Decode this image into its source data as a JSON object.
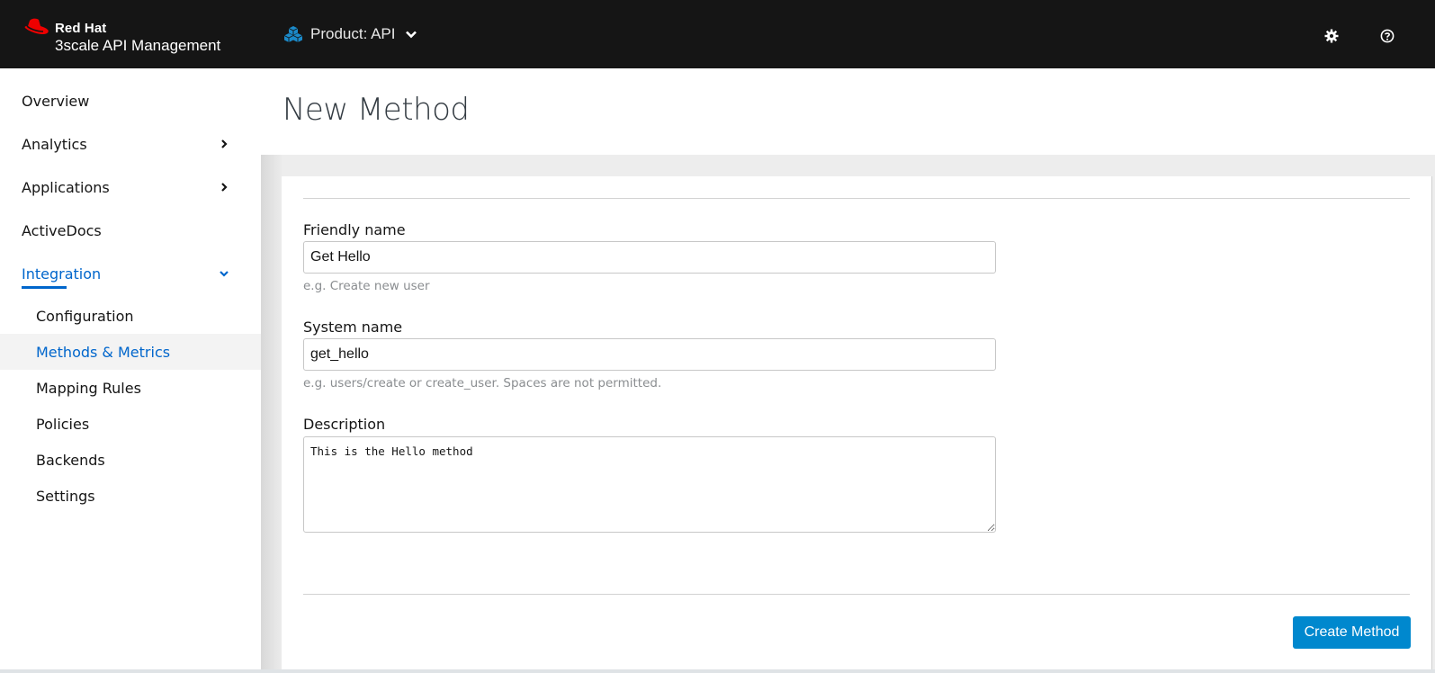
{
  "masthead": {
    "brand_line1": "Red Hat",
    "brand_line2": "3scale API Management",
    "context_label": "Product: API",
    "icons": [
      "redhat-logo",
      "product-cubes-icon",
      "chevron-down-icon",
      "gear-icon",
      "help-icon"
    ]
  },
  "sidebar": {
    "items": [
      {
        "label": "Overview",
        "expandable": false
      },
      {
        "label": "Analytics",
        "expandable": true,
        "expanded": false
      },
      {
        "label": "Applications",
        "expandable": true,
        "expanded": false
      },
      {
        "label": "ActiveDocs",
        "expandable": false
      },
      {
        "label": "Integration",
        "expandable": true,
        "expanded": true,
        "active": true
      }
    ],
    "sub_items": [
      {
        "label": "Configuration"
      },
      {
        "label": "Methods & Metrics",
        "current": true
      },
      {
        "label": "Mapping Rules"
      },
      {
        "label": "Policies"
      },
      {
        "label": "Backends"
      },
      {
        "label": "Settings"
      }
    ]
  },
  "page": {
    "title": "New Method"
  },
  "form": {
    "friendly_name": {
      "label": "Friendly name",
      "value": "Get Hello",
      "helper": "e.g. Create new user"
    },
    "system_name": {
      "label": "System name",
      "value": "get_hello",
      "helper": "e.g. users/create or create_user. Spaces are not permitted."
    },
    "description": {
      "label": "Description",
      "value": "This is the Hello method"
    },
    "submit_label": "Create Method"
  },
  "colors": {
    "masthead_bg": "#151515",
    "accent_blue": "#0066cc",
    "button_blue": "#0088ce",
    "redhat_red": "#ee0000",
    "cubes_blue": "#1b8ac9"
  }
}
